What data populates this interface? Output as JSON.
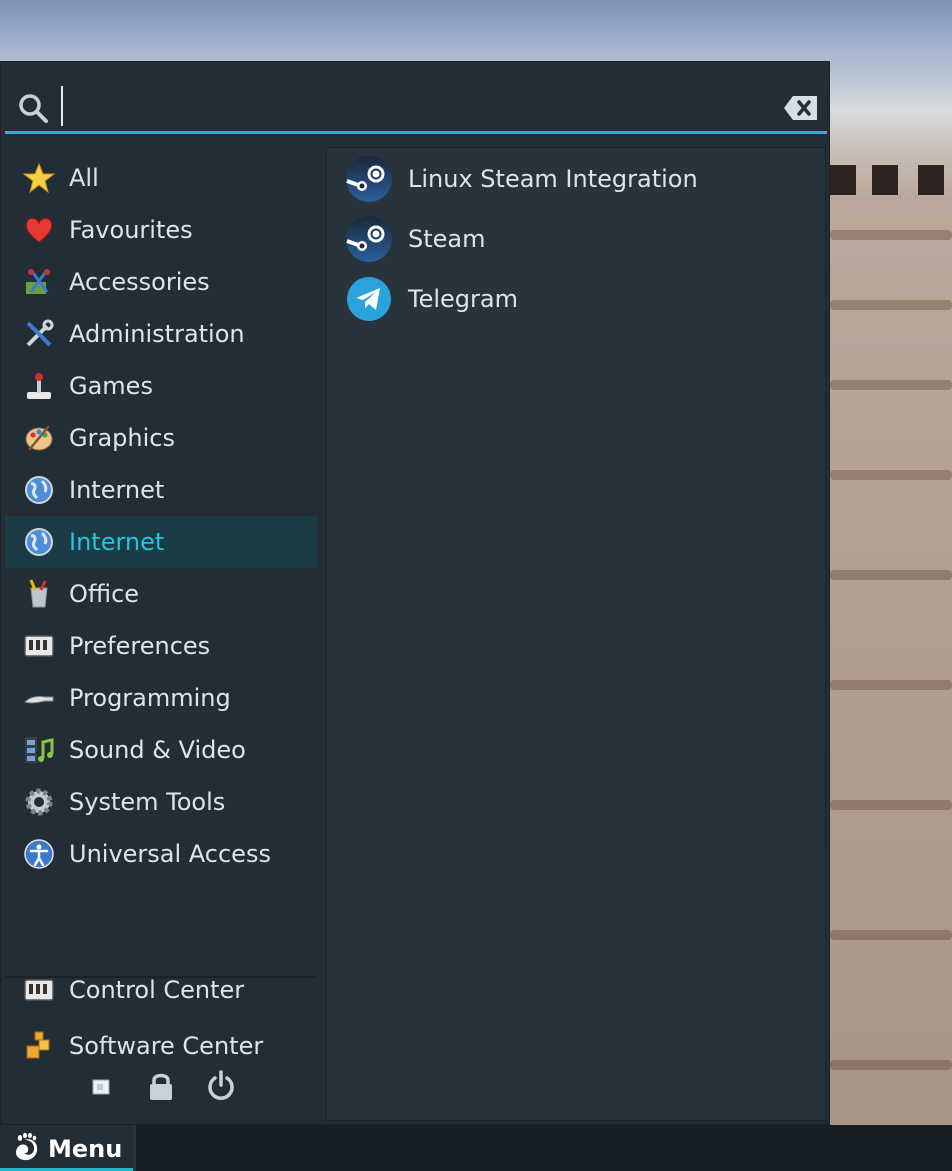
{
  "search": {
    "value": "",
    "placeholder": ""
  },
  "categories": [
    {
      "label": "All",
      "icon": "star-icon"
    },
    {
      "label": "Favourites",
      "icon": "heart-icon"
    },
    {
      "label": "Accessories",
      "icon": "accessories-icon"
    },
    {
      "label": "Administration",
      "icon": "tools-icon"
    },
    {
      "label": "Games",
      "icon": "joystick-icon"
    },
    {
      "label": "Graphics",
      "icon": "palette-icon"
    },
    {
      "label": "Internet",
      "icon": "globe-icon"
    },
    {
      "label": "Internet",
      "icon": "globe-icon",
      "selected": true
    },
    {
      "label": "Office",
      "icon": "office-icon"
    },
    {
      "label": "Preferences",
      "icon": "preferences-icon"
    },
    {
      "label": "Programming",
      "icon": "programming-icon"
    },
    {
      "label": "Sound & Video",
      "icon": "multimedia-icon"
    },
    {
      "label": "System Tools",
      "icon": "gear-icon"
    },
    {
      "label": "Universal Access",
      "icon": "accessibility-icon"
    }
  ],
  "places": [
    {
      "label": "Control Center",
      "icon": "control-center-icon"
    },
    {
      "label": "Software Center",
      "icon": "software-center-icon"
    }
  ],
  "apps": [
    {
      "label": "Linux Steam Integration",
      "icon": "steam-icon"
    },
    {
      "label": "Steam",
      "icon": "steam-icon"
    },
    {
      "label": "Telegram",
      "icon": "telegram-icon"
    }
  ],
  "actions": [
    {
      "icon": "user-icon"
    },
    {
      "icon": "lock-icon"
    },
    {
      "icon": "power-icon"
    }
  ],
  "taskbar": {
    "menu_label": "Menu"
  },
  "colors": {
    "accent": "#22b4cc",
    "panel_bg": "#232d35",
    "apps_bg": "#28333c",
    "text": "#dfe4e8",
    "selected_bg": "#1c3c45"
  }
}
